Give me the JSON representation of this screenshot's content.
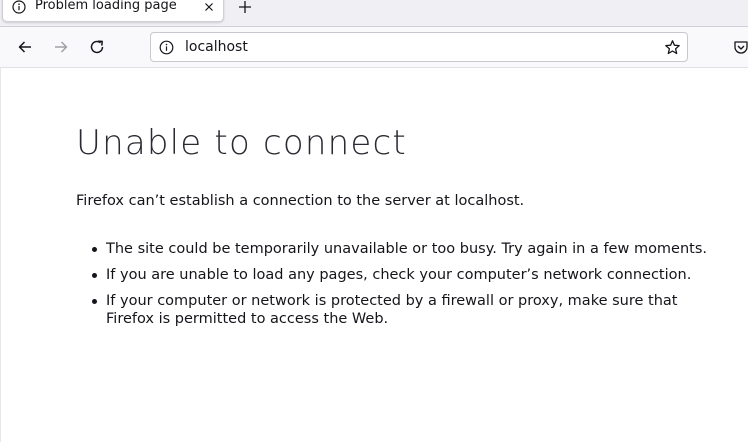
{
  "tab": {
    "title": "Problem loading page",
    "icon": "info-icon",
    "close_icon": "close-icon"
  },
  "newtab_icon": "plus-icon",
  "nav": {
    "back_icon": "arrow-left-icon",
    "forward_icon": "arrow-right-icon",
    "reload_icon": "reload-icon"
  },
  "urlbar": {
    "value": "localhost",
    "info_icon": "info-icon",
    "bookmark_icon": "star-icon"
  },
  "pocket_icon": "pocket-icon",
  "error": {
    "title": "Unable to connect",
    "description": "Firefox can’t establish a connection to the server at localhost.",
    "suggestions": [
      "The site could be temporarily unavailable or too busy. Try again in a few moments.",
      "If you are unable to load any pages, check your computer’s network connection.",
      "If your computer or network is protected by a firewall or proxy, make sure that Firefox is permitted to access the Web."
    ]
  }
}
